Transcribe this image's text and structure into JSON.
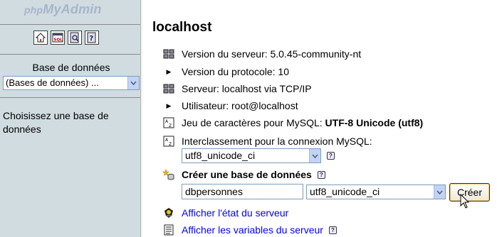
{
  "nav": {
    "logo_php": "php",
    "logo_myadmin": "MyAdmin",
    "icons": [
      "home-icon",
      "sql-icon",
      "query-window-icon",
      "documentation-icon"
    ],
    "db_label": "Base de données",
    "db_select_value": "(Bases de données) ...",
    "hint": "Choisissez une base de données"
  },
  "main": {
    "title": "localhost",
    "server_version": "Version du serveur: 5.0.45-community-nt",
    "protocol_version": "Version du protocole: 10",
    "server": "Serveur: localhost via TCP/IP",
    "user": "Utilisateur: root@localhost",
    "charset_label": "Jeu de caractères pour MySQL: ",
    "charset_value": "UTF-8 Unicode (utf8)",
    "collation_label": "Interclassement pour la connexion MySQL:",
    "collation_value": "utf8_unicode_ci",
    "create_db_label": "Créer une base de données",
    "new_db_name": "dbpersonnes",
    "new_db_collation": "utf8_unicode_ci",
    "create_button": "Créer",
    "link_status": "Afficher l'état du serveur",
    "link_variables": "Afficher les variables du serveur"
  },
  "colors": {
    "nav_bg": "#d0dce0",
    "link": "#0000ff",
    "logo": "#a8b4cc"
  }
}
